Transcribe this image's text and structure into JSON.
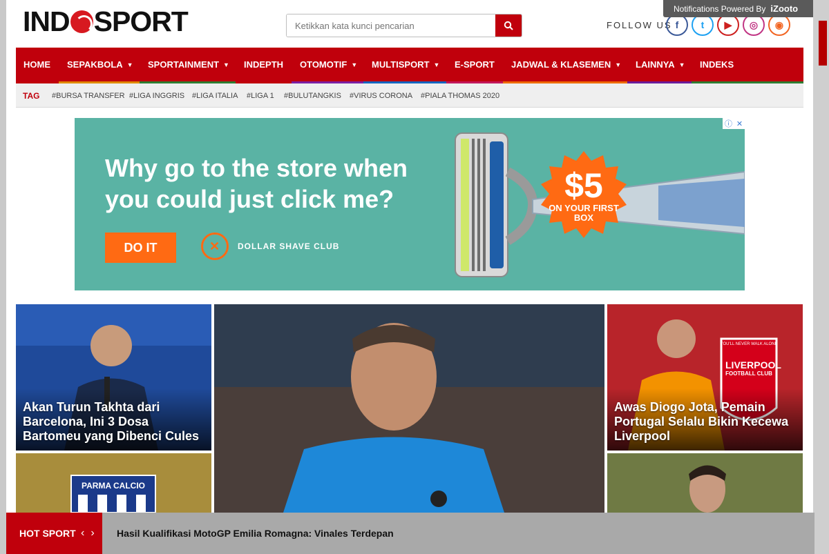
{
  "header": {
    "logo_left": "IND",
    "logo_right": "SPORT",
    "search_placeholder": "Ketikkan kata kunci pencarian",
    "follow_label": "FOLLOW US",
    "notification": {
      "text": "Notifications Powered By",
      "brand": "iZooto"
    },
    "social": [
      {
        "name": "facebook-icon",
        "glyph": "f",
        "color": "#3b5998"
      },
      {
        "name": "twitter-icon",
        "glyph": "t",
        "color": "#1da1f2"
      },
      {
        "name": "youtube-icon",
        "glyph": "▶",
        "color": "#cd201f"
      },
      {
        "name": "instagram-icon",
        "glyph": "◎",
        "color": "#c13584"
      },
      {
        "name": "rss-icon",
        "glyph": "◉",
        "color": "#f26522"
      }
    ]
  },
  "nav": {
    "items": [
      {
        "label": "HOME",
        "caret": false
      },
      {
        "label": "SEPAKBOLA",
        "caret": true
      },
      {
        "label": "SPORTAINMENT",
        "caret": true
      },
      {
        "label": "INDEPTH",
        "caret": false
      },
      {
        "label": "OTOMOTIF",
        "caret": true
      },
      {
        "label": "MULTISPORT",
        "caret": true
      },
      {
        "label": "E-SPORT",
        "caret": false
      },
      {
        "label": "JADWAL & KLASEMEN",
        "caret": true
      },
      {
        "label": "LAINNYA",
        "caret": true
      },
      {
        "label": "INDEKS",
        "caret": false
      }
    ],
    "strip_colors": [
      "#c0000c",
      "#e08a00",
      "#2e7d32",
      "#c0000c",
      "#7b1fa2",
      "#1565c0",
      "#c2185b",
      "#ef6c00",
      "#6a1b9a",
      "#2e7d32"
    ]
  },
  "tags": {
    "label": "TAG",
    "items": [
      "#BURSA TRANSFER",
      "#LIGA INGGRIS",
      "#LIGA ITALIA",
      "#LIGA 1",
      "#BULUTANGKIS",
      "#VIRUS CORONA",
      "#PIALA THOMAS 2020"
    ]
  },
  "ad": {
    "headline": "Why go to the store when you could just click me?",
    "cta": "DO IT",
    "brand": "DOLLAR SHAVE CLUB",
    "price": "$5",
    "price_sub": "ON YOUR FIRST BOX",
    "choice_icons": [
      "ⓘ",
      "✕"
    ]
  },
  "cards": [
    {
      "name": "card-bartomeu",
      "title": "Akan Turun Takhta dari Barcelona, Ini 3 Dosa Bartomeu yang Dibenci Cules"
    },
    {
      "name": "card-jota",
      "title": "Awas Diogo Jota, Pemain Portugal Selalu Bikin Kecewa Liverpool"
    }
  ],
  "image_text": {
    "parma": "PARMA CALCIO",
    "liverpool": "LIVERPOOL",
    "liverpool_sub": "FOOTBALL CLUB",
    "ynwa": "YOU'LL NEVER WALK ALONE"
  },
  "hot": {
    "label": "HOT SPORT",
    "prev": "‹",
    "next": "›",
    "headline": "Hasil Kualifikasi MotoGP Emilia Romagna: Vinales Terdepan"
  }
}
